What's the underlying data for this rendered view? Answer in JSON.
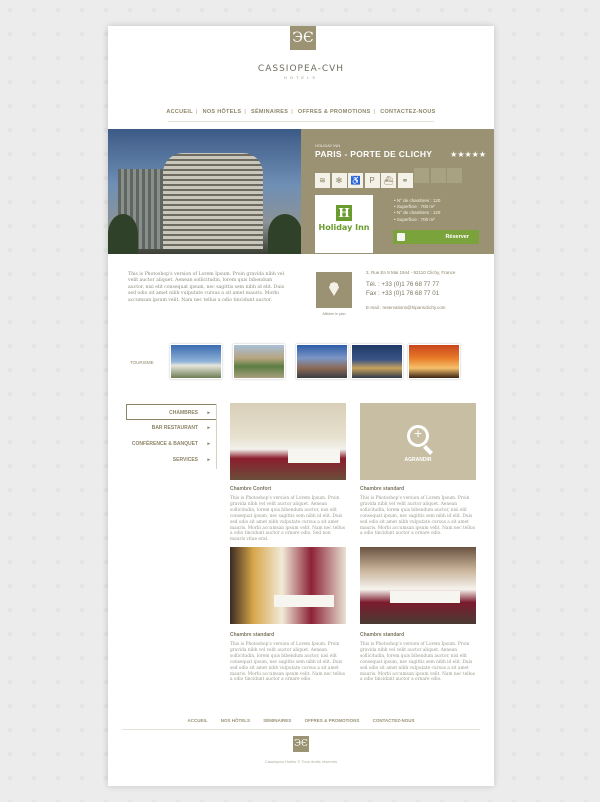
{
  "brand": {
    "logo_glyph": "ЭЄ",
    "name": "CASSIOPEA-CVH",
    "subtitle": "HOTELS"
  },
  "nav": [
    "ACCUEIL",
    "NOS HÔTELS",
    "SÉMINAIRES",
    "OFFRES & PROMOTIONS",
    "CONTACTEZ-NOUS"
  ],
  "hero": {
    "label": "HOLIDAY INN",
    "title": "PARIS - PORTE DE CLICHY",
    "stars": "★★★★★",
    "amenities": [
      "wifi-icon",
      "snowflake-icon",
      "wheelchair-icon",
      "parking-icon",
      "pool-icon",
      "restaurant-icon"
    ],
    "amenity_glyphs": [
      "≋",
      "✻",
      "♿",
      "P",
      "⛴",
      "⚭"
    ],
    "hotel_logo_mark": "H",
    "hotel_logo_text": "Holiday Inn",
    "specs": [
      "N° de chambres : 120",
      "Superficie : 700 m²",
      "N° de chambres : 120",
      "Superficie : 700 m²"
    ],
    "reserve_label": "Réserver"
  },
  "description": "This is Photoshop's version of Lorem Ipsum. Proin gravida nibh vel velit auctor aliquet. Aenean sollicitudin, lorem quis bibendum auctor, nisi elit consequat ipsum, nec sagittis sem nibh id elit. Duis sed odio sit amet nibh vulputate cursus a sit amet mauris. Morbi accumsan ipsum velit. Nam nec tellus a odio tincidunt auctor.",
  "map_caption": "Afficher le plan",
  "contact": {
    "address": "3, Rue En 8 Mai 1944 - 92110 Clichy, France",
    "tel": "Tél. : +33 (0)1 76 68 77 77",
    "fax": "Fax : +33 (0)1 76 68 77 01",
    "email": "E-mail : reservations@hiparisclichy.com"
  },
  "tourism_label": "TOURISME",
  "sidebar": [
    "CHAMBRES",
    "BAR RESTAURANT",
    "CONFÉRENCE & BANQUET",
    "SERVICES"
  ],
  "sidebar_arrow": "▸",
  "rooms": [
    {
      "title": "Chambre Confort",
      "text": "This is Photoshop's version of Lorem Ipsum. Proin gravida nibh vel velit auctor aliquet. Aenean sollicitudin, lorem quis bibendum auctor, nisi elit consequat ipsum, nec sagittis sem nibh id elit. Duis sed odio sit amet nibh vulputate cursus a sit amet mauris. Morbi accumsan ipsum velit. Nam nec tellus a odio tincidunt auctor a ornare odio. Sed non mauris vitae erat."
    },
    {
      "title": "Chambre standard",
      "text": "This is Photoshop's version of Lorem Ipsum. Proin gravida nibh vel velit auctor aliquet. Aenean sollicitudin, lorem quis bibendum auctor, nisi elit consequat ipsum, nec sagittis sem nibh id elit. Duis sed odio sit amet nibh vulputate cursus a sit amet mauris. Morbi accumsan ipsum velit. Nam nec tellus a odio tincidunt auctor a ornare odio."
    },
    {
      "title": "Chambre standard",
      "text": "This is Photoshop's version of Lorem Ipsum. Proin gravida nibh vel velit auctor aliquet. Aenean sollicitudin, lorem quis bibendum auctor, nisi elit consequat ipsum, nec sagittis sem nibh id elit. Duis sed odio sit amet nibh vulputate cursus a sit amet mauris. Morbi accumsan ipsum velit. Nam nec tellus a odio tincidunt auctor a ornare odio."
    },
    {
      "title": "Chambre standard",
      "text": "This is Photoshop's version of Lorem Ipsum. Proin gravida nibh vel velit auctor aliquet. Aenean sollicitudin, lorem quis bibendum auctor, nisi elit consequat ipsum, nec sagittis sem nibh id elit. Duis sed odio sit amet nibh vulputate cursus a sit amet mauris. Morbi accumsan ipsum velit. Nam nec tellus a odio tincidunt auctor a ornare odio."
    }
  ],
  "zoom_label": "AGRANDIR",
  "footer": {
    "nav": [
      "ACCUEIL",
      "NOS HÔTELS",
      "SÉMINAIRES",
      "OFFRES & PROMOTIONS",
      "CONTACTEZ-NOUS"
    ],
    "copyright": "Cassiopea Hotels © Tous droits réservés"
  },
  "colors": {
    "accent": "#9a9272",
    "reserve": "#7ba33c",
    "holiday_inn": "#6a9b2e"
  }
}
